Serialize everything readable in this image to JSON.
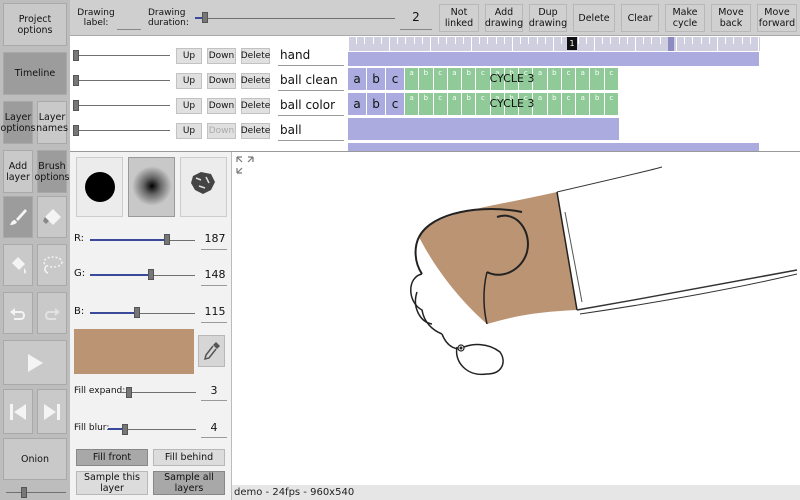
{
  "sidebar": {
    "project_options": "Project options",
    "timeline": "Timeline",
    "layer_options": "Layer options",
    "layer_names": "Layer names",
    "add_layer": "Add layer",
    "brush_options": "Brush options",
    "onion": "Onion",
    "onion_slider": 0.3
  },
  "toolbar": {
    "drawing_label": "Drawing label:",
    "drawing_duration": "Drawing duration:",
    "duration_value": "2",
    "duration_slider": 0.05,
    "not_linked": "Not linked",
    "add_drawing": "Add drawing",
    "dup_drawing": "Dup drawing",
    "delete": "Delete",
    "clear": "Clear",
    "make_cycle": "Make cycle",
    "move_back": "Move back",
    "move_forward": "Move forward"
  },
  "timeline": {
    "current_frame": "1",
    "layers": [
      {
        "name": "hand",
        "up": "Up",
        "down": "Down",
        "delete": "Delete",
        "down_enabled": true
      },
      {
        "name": "ball clean",
        "up": "Up",
        "down": "Down",
        "delete": "Delete",
        "down_enabled": true,
        "cells": [
          "a",
          "b",
          "c"
        ],
        "cycle_label": "CYCLE 3",
        "cycle_small": [
          "a",
          "b",
          "c",
          "a",
          "b",
          "c",
          "a",
          "b",
          "c",
          "a",
          "b",
          "c",
          "a",
          "b",
          "c"
        ]
      },
      {
        "name": "ball color",
        "up": "Up",
        "down": "Down",
        "delete": "Delete",
        "down_enabled": true,
        "cells": [
          "a",
          "b",
          "c"
        ],
        "cycle_label": "CYCLE 3",
        "cycle_small": [
          "a",
          "b",
          "c",
          "a",
          "b",
          "c",
          "a",
          "b",
          "c",
          "a",
          "b",
          "c",
          "a",
          "b",
          "c"
        ]
      },
      {
        "name": "ball",
        "up": "Up",
        "down": "Down",
        "delete": "Delete",
        "down_enabled": false
      }
    ]
  },
  "brush": {
    "r_label": "R:",
    "r_value": "187",
    "g_label": "G:",
    "g_value": "148",
    "b_label": "B:",
    "b_value": "115",
    "swatch_color": "#bb9473",
    "fill_expand_label": "Fill expand:",
    "fill_expand_value": "3",
    "fill_blur_label": "Fill blur:",
    "fill_blur_value": "4",
    "fill_front": "Fill front",
    "fill_behind": "Fill behind",
    "sample_this_layer": "Sample this layer",
    "sample_all_layers": "Sample all layers"
  },
  "status": {
    "text": "demo - 24fps - 960x540"
  },
  "colors": {
    "layer_bar": "#ababdf",
    "cycle_cell": "#8fca98",
    "fill_brown": "#bb9473"
  }
}
